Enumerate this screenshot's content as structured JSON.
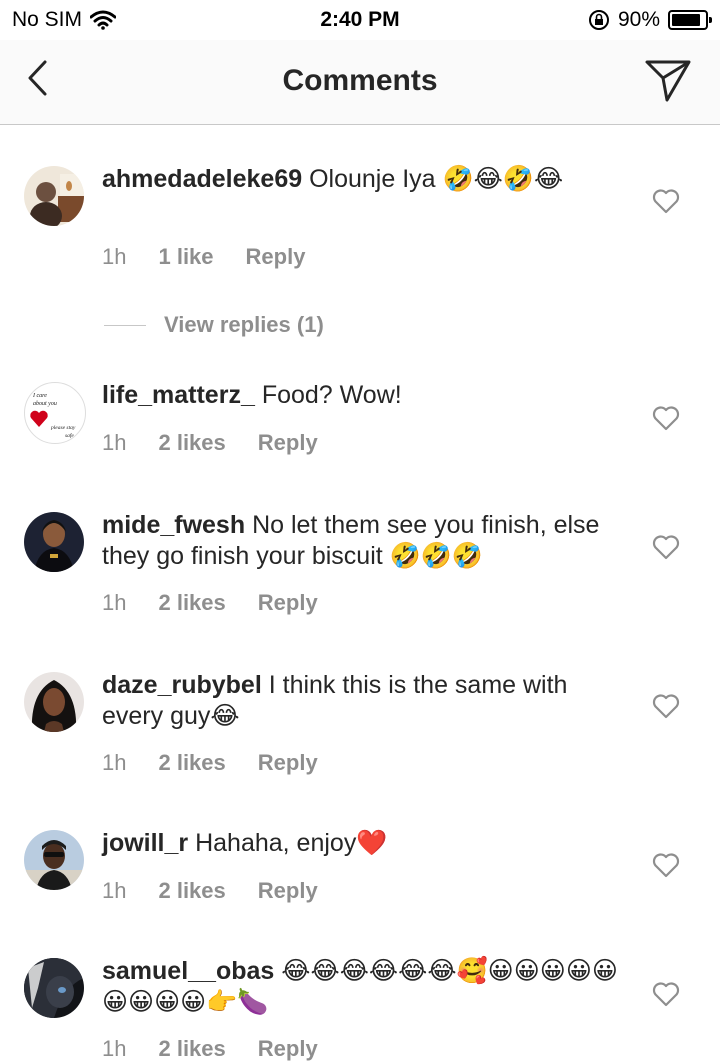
{
  "status_bar": {
    "carrier": "No SIM",
    "time": "2:40 PM",
    "battery": "90%",
    "battery_level": 0.9
  },
  "header": {
    "title": "Comments",
    "back_icon": "chevron-left-icon",
    "share_icon": "paper-plane-icon"
  },
  "comments": [
    {
      "username": "ahmedadeleke69",
      "text": "Olounje Iya 🤣😂🤣😂",
      "time": "1h",
      "likes": "1 like",
      "reply": "Reply",
      "view_replies": "View replies (1)"
    },
    {
      "username": "life_matterz_",
      "text": "Food? Wow!",
      "time": "1h",
      "likes": "2 likes",
      "reply": "Reply",
      "avatar_text": [
        "I care",
        "about you",
        "please stay",
        "safe"
      ]
    },
    {
      "username": "mide_fwesh",
      "text": "No let them see you finish, else they go finish your biscuit 🤣🤣🤣",
      "time": "1h",
      "likes": "2 likes",
      "reply": "Reply"
    },
    {
      "username": "daze_rubybel",
      "text": "I think this is the same with every guy😂",
      "time": "1h",
      "likes": "2 likes",
      "reply": "Reply"
    },
    {
      "username": "jowill_r",
      "text": "Hahaha, enjoy❤️",
      "time": "1h",
      "likes": "2 likes",
      "reply": "Reply"
    },
    {
      "username": "samuel__obas",
      "text": "😂😂😂😂😂😂🥰😀😀😀😀😀😀😀😀😀👉🍆",
      "time": "1h",
      "likes": "2 likes",
      "reply": "Reply"
    }
  ]
}
